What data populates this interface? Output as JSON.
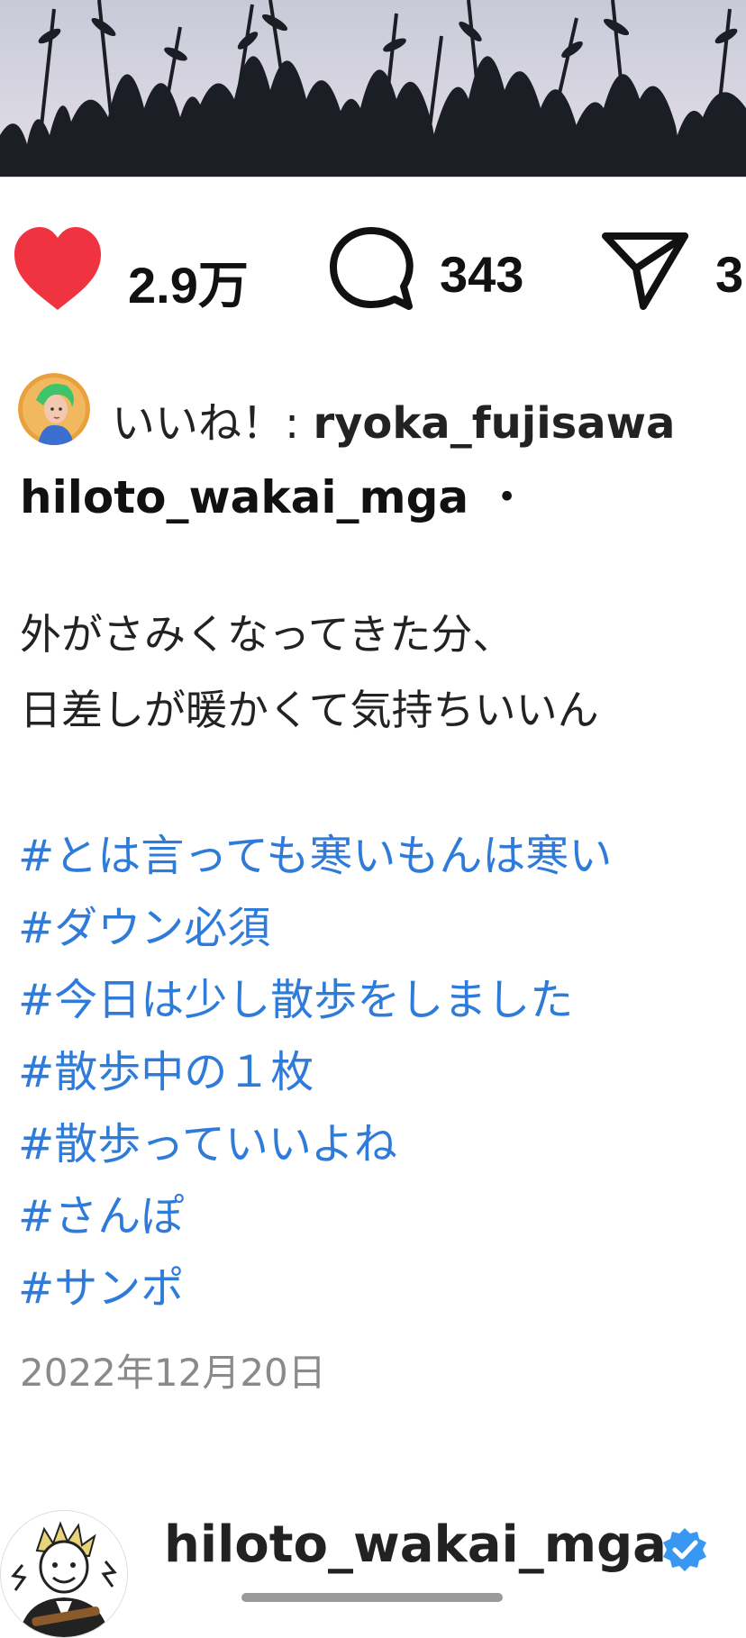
{
  "post": {
    "like_count": "2.9万",
    "comment_count": "343",
    "share_count": "3",
    "liked_by_prefix": "いいね！: ",
    "liked_by_user": "ryoka_fujisawa",
    "author": "hiloto_wakai_mga",
    "author_separator": "・",
    "caption_lines": [
      "外がさみくなってきた分、",
      "日差しが暖かくて気持ちいいん"
    ],
    "hashtags": [
      "#とは言っても寒いもんは寒い",
      "#ダウン必須",
      "#今日は少し散歩をしました",
      "#散歩中の１枚",
      "#散歩っていいよね",
      "#さんぽ",
      "#サンポ"
    ],
    "date": "2022年12月20日"
  },
  "next_post": {
    "username": "hiloto_wakai_mga"
  },
  "icons": {
    "like": "heart-filled-icon",
    "comment": "comment-bubble-icon",
    "share": "paper-plane-icon",
    "verified": "verified-badge-icon"
  },
  "colors": {
    "like_red": "#ef3340",
    "hashtag_blue": "#2f7bd9",
    "date_gray": "#8a8a8a",
    "verified_blue": "#3897f0"
  }
}
